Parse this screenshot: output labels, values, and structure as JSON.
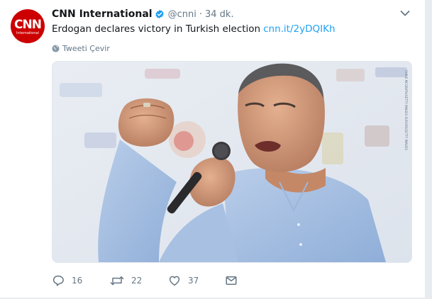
{
  "tweet": {
    "avatar": {
      "logo_main": "CNN",
      "logo_sub": "International"
    },
    "author_name": "CNN International",
    "handle": "@cnni",
    "separator": "·",
    "time": "34 dk.",
    "text": "Erdogan declares victory in Turkish election",
    "link_text": "cnn.it/2yDQIKh",
    "translate_label": "Tweeti Çevir",
    "image_credit": "CHRIS MCGRATH/GETTY IMAGES EUROPE/GETTY IMAGES",
    "stats": {
      "replies": "16",
      "retweets": "22",
      "likes": "37"
    }
  },
  "icons": {
    "verified": "verified-badge-icon",
    "caret": "chevron-down-icon",
    "translate": "globe-icon",
    "reply": "reply-icon",
    "retweet": "retweet-icon",
    "like": "heart-icon",
    "message": "envelope-icon"
  },
  "colors": {
    "brand_blue": "#1da1f2",
    "cnn_red": "#cc0000",
    "muted_text": "#657786",
    "text": "#14171a",
    "background": "#e6ecf0"
  }
}
